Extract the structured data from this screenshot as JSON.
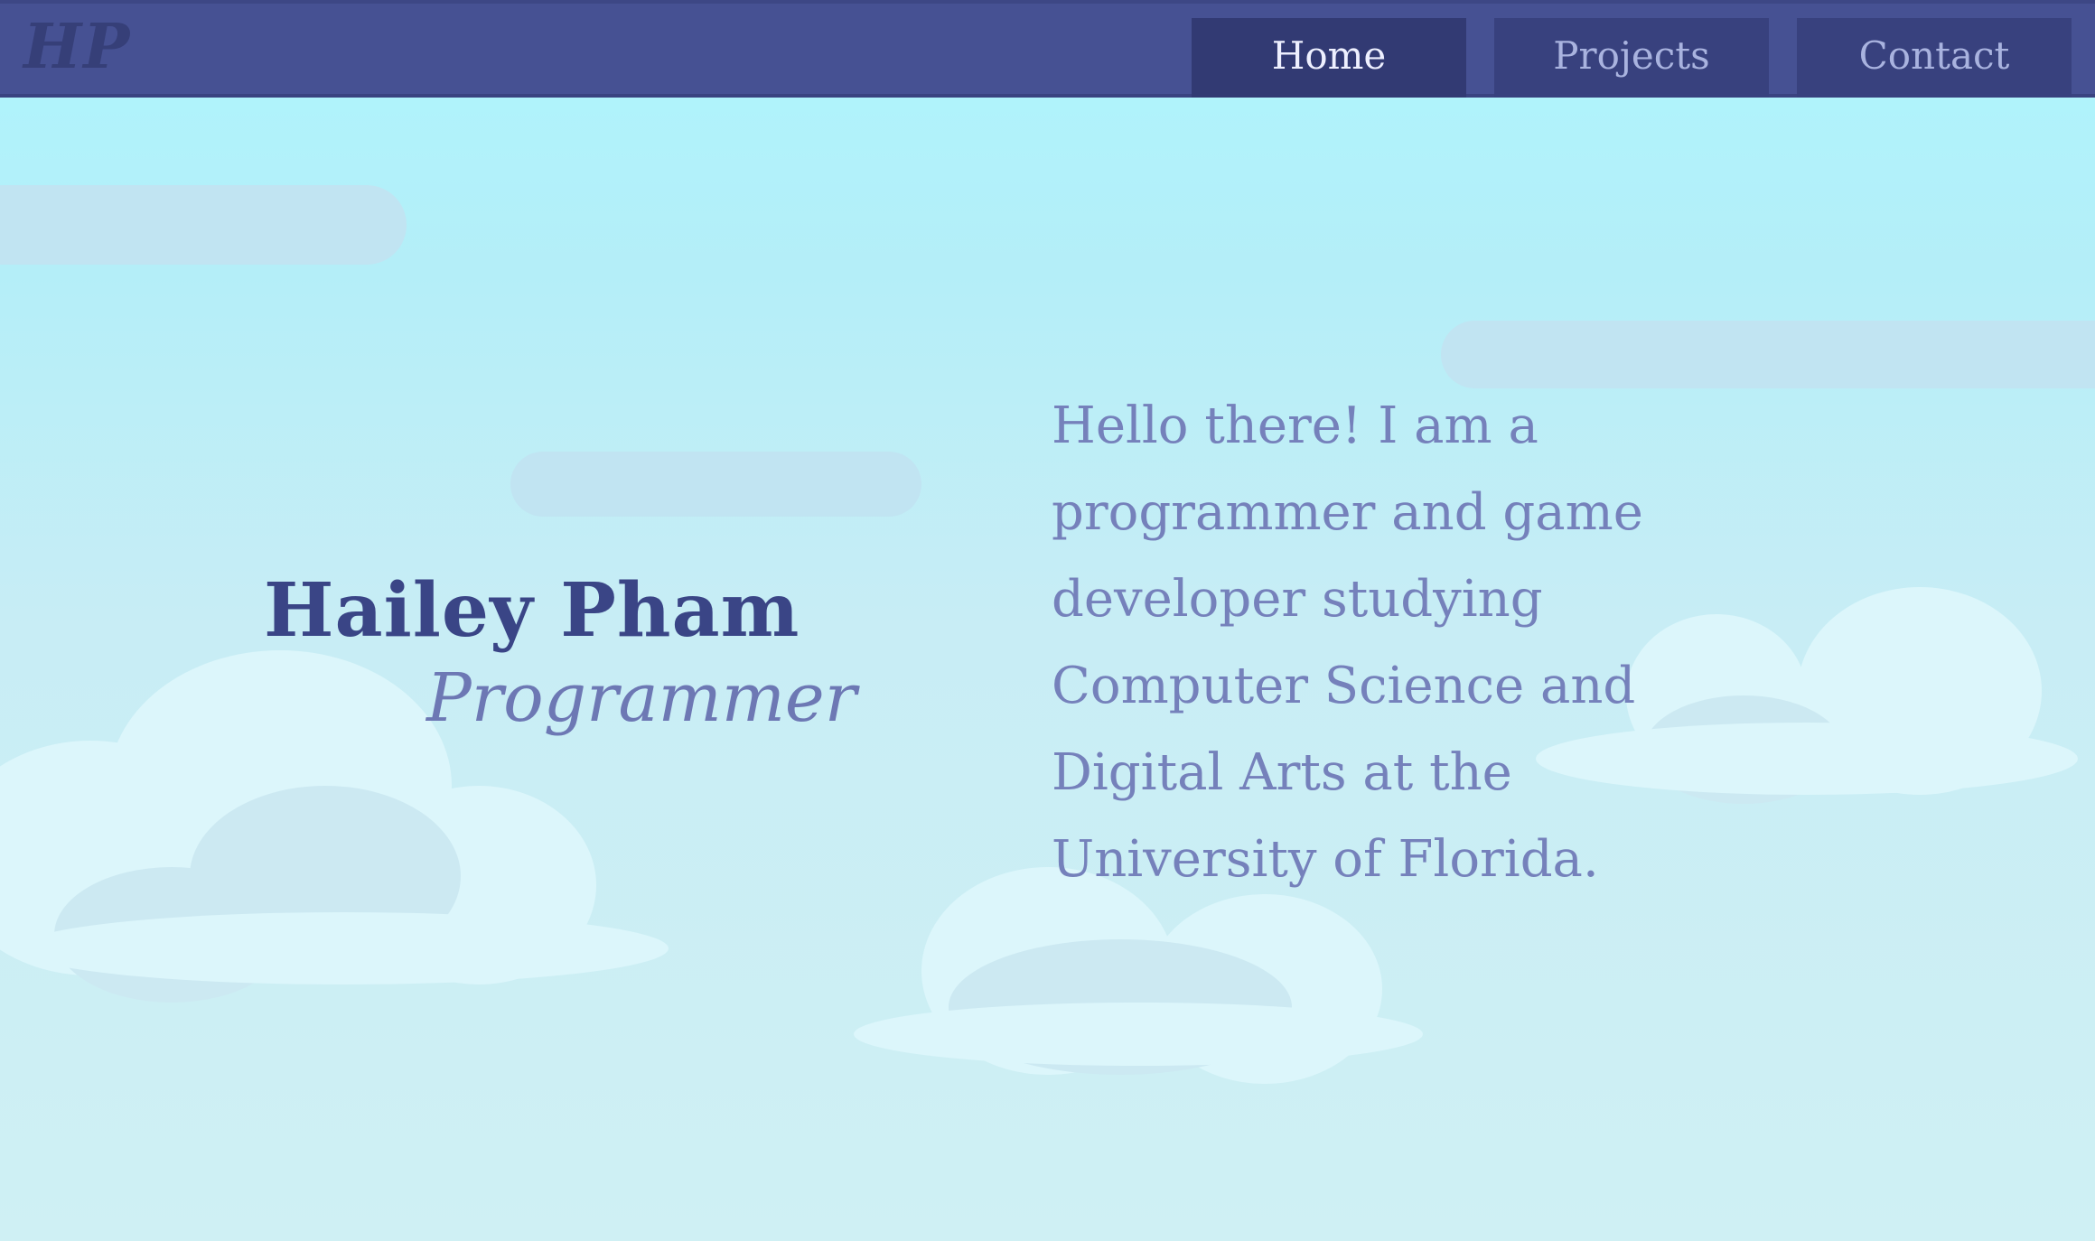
{
  "nav": {
    "logo": "HP",
    "items": [
      {
        "label": "Home",
        "active": true
      },
      {
        "label": "Projects",
        "active": false
      },
      {
        "label": "Contact",
        "active": false
      }
    ]
  },
  "hero": {
    "name": "Hailey Pham",
    "role": "Programmer",
    "bio": "Hello there! I am a programmer and game developer studying Computer Science and Digital Arts at the University of Florida."
  },
  "colors": {
    "navbar": "#465193",
    "nav_button": "#38417e",
    "nav_button_active": "#323a73",
    "sky_top": "#aef6fd",
    "sky_bottom": "#cff0f4",
    "name_text": "#3a4586",
    "role_text": "#6d78b4",
    "bio_text": "#7581bb"
  }
}
